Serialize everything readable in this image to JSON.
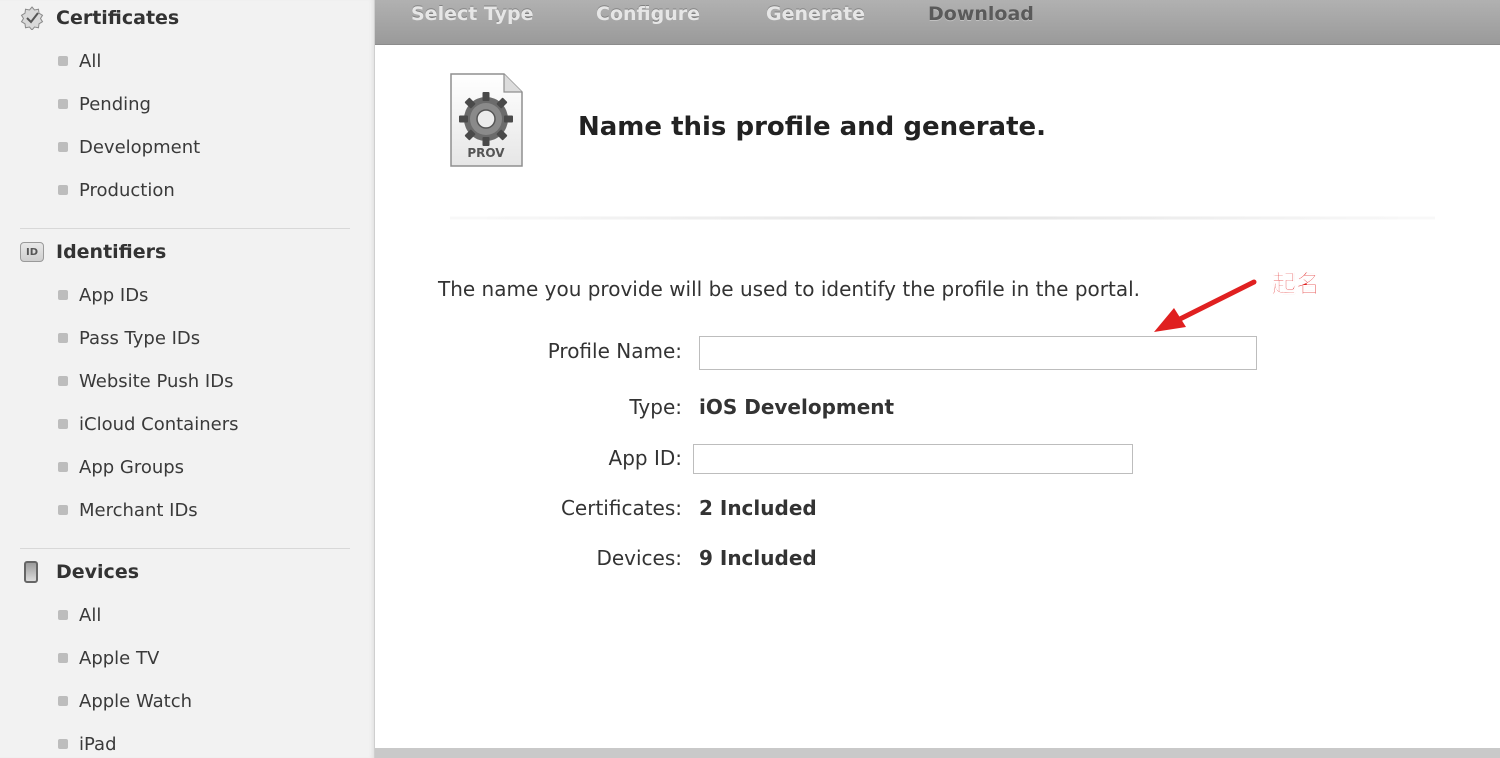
{
  "sidebar": {
    "certificates": {
      "title": "Certificates",
      "items": [
        "All",
        "Pending",
        "Development",
        "Production"
      ]
    },
    "identifiers": {
      "badge": "ID",
      "title": "Identifiers",
      "items": [
        "App IDs",
        "Pass Type IDs",
        "Website Push IDs",
        "iCloud Containers",
        "App Groups",
        "Merchant IDs"
      ]
    },
    "devices": {
      "title": "Devices",
      "items": [
        "All",
        "Apple TV",
        "Apple Watch",
        "iPad"
      ]
    }
  },
  "steps": [
    "Select Type",
    "Configure",
    "Generate",
    "Download"
  ],
  "main": {
    "icon_label": "PROV",
    "title": "Name this profile and generate.",
    "description": "The name you provide will be used to identify the profile in the portal.",
    "profile_name_label": "Profile Name:",
    "profile_name_value": "",
    "type_label": "Type:",
    "type_value": "iOS Development",
    "app_id_label": "App ID:",
    "app_id_value": "",
    "certificates_label": "Certificates:",
    "certificates_value": "2 Included",
    "devices_label": "Devices:",
    "devices_value": "9 Included"
  },
  "annotation": {
    "text": "起名",
    "color": "#e02020"
  }
}
